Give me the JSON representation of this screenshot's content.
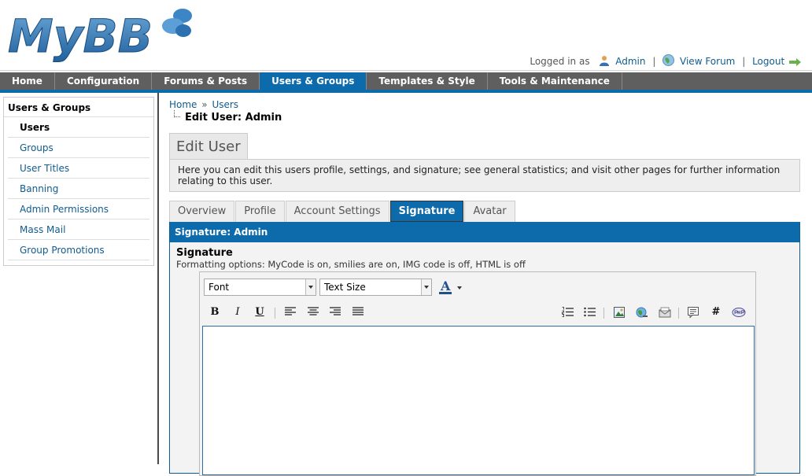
{
  "logo": {
    "text": "MyBB"
  },
  "userbar": {
    "logged_in_as": "Logged in as",
    "user": "Admin",
    "view_forum": "View Forum",
    "logout": "Logout",
    "sep": "|"
  },
  "nav": {
    "items": [
      {
        "label": "Home"
      },
      {
        "label": "Configuration"
      },
      {
        "label": "Forums & Posts"
      },
      {
        "label": "Users & Groups",
        "active": true
      },
      {
        "label": "Templates & Style"
      },
      {
        "label": "Tools & Maintenance"
      }
    ]
  },
  "sidebar": {
    "title": "Users & Groups",
    "items": [
      {
        "label": "Users",
        "active": true
      },
      {
        "label": "Groups"
      },
      {
        "label": "User Titles"
      },
      {
        "label": "Banning"
      },
      {
        "label": "Admin Permissions"
      },
      {
        "label": "Mass Mail"
      },
      {
        "label": "Group Promotions"
      }
    ]
  },
  "breadcrumb": {
    "home": "Home",
    "sep": "»",
    "users": "Users",
    "current": "Edit User: Admin"
  },
  "page": {
    "heading": "Edit User",
    "intro": "Here you can edit this users profile, settings, and signature; see general statistics; and visit other pages for further information relating to this user."
  },
  "tabs": [
    {
      "label": "Overview"
    },
    {
      "label": "Profile"
    },
    {
      "label": "Account Settings"
    },
    {
      "label": "Signature",
      "active": true
    },
    {
      "label": "Avatar"
    }
  ],
  "panel": {
    "title": "Signature: Admin",
    "field_label": "Signature",
    "field_desc": "Formatting options: MyCode is on, smilies are on, IMG code is off, HTML is off"
  },
  "editor": {
    "font_select": "Font",
    "size_select": "Text Size",
    "color_letter": "A",
    "bold": "B",
    "italic": "I",
    "underline": "U",
    "hash": "#",
    "body": ""
  },
  "colors": {
    "nav_bg": "#5f5f5f",
    "accent": "#0e6bab",
    "link": "#0f5c8e"
  }
}
